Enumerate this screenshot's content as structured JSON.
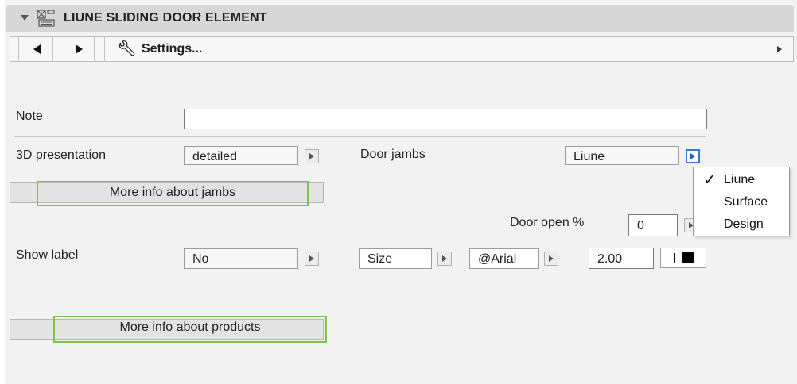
{
  "header": {
    "title": "LIUNE SLIDING DOOR ELEMENT",
    "icon": "door-element-icon"
  },
  "toolbar": {
    "settings_label": "Settings..."
  },
  "fields": {
    "note_label": "Note",
    "note_value": "",
    "presentation_label": "3D presentation",
    "presentation_value": "detailed",
    "door_jambs_label": "Door jambs",
    "door_jambs_value": "Liune",
    "more_jambs_label": "More info about jambs",
    "door_open_label": "Door open %",
    "door_open_value": "0",
    "show_label_label": "Show label",
    "show_label_value": "No",
    "size_value": "Size",
    "font_value": "@Arial",
    "text_height_value": "2.00",
    "more_products_label": "More info about products"
  },
  "popup": {
    "items": [
      {
        "label": "Liune",
        "checked": true
      },
      {
        "label": "Surface",
        "checked": false
      },
      {
        "label": "Design",
        "checked": false
      }
    ]
  },
  "colors": {
    "highlight": "#7cc24c",
    "active_button": "#2f7bd6"
  }
}
